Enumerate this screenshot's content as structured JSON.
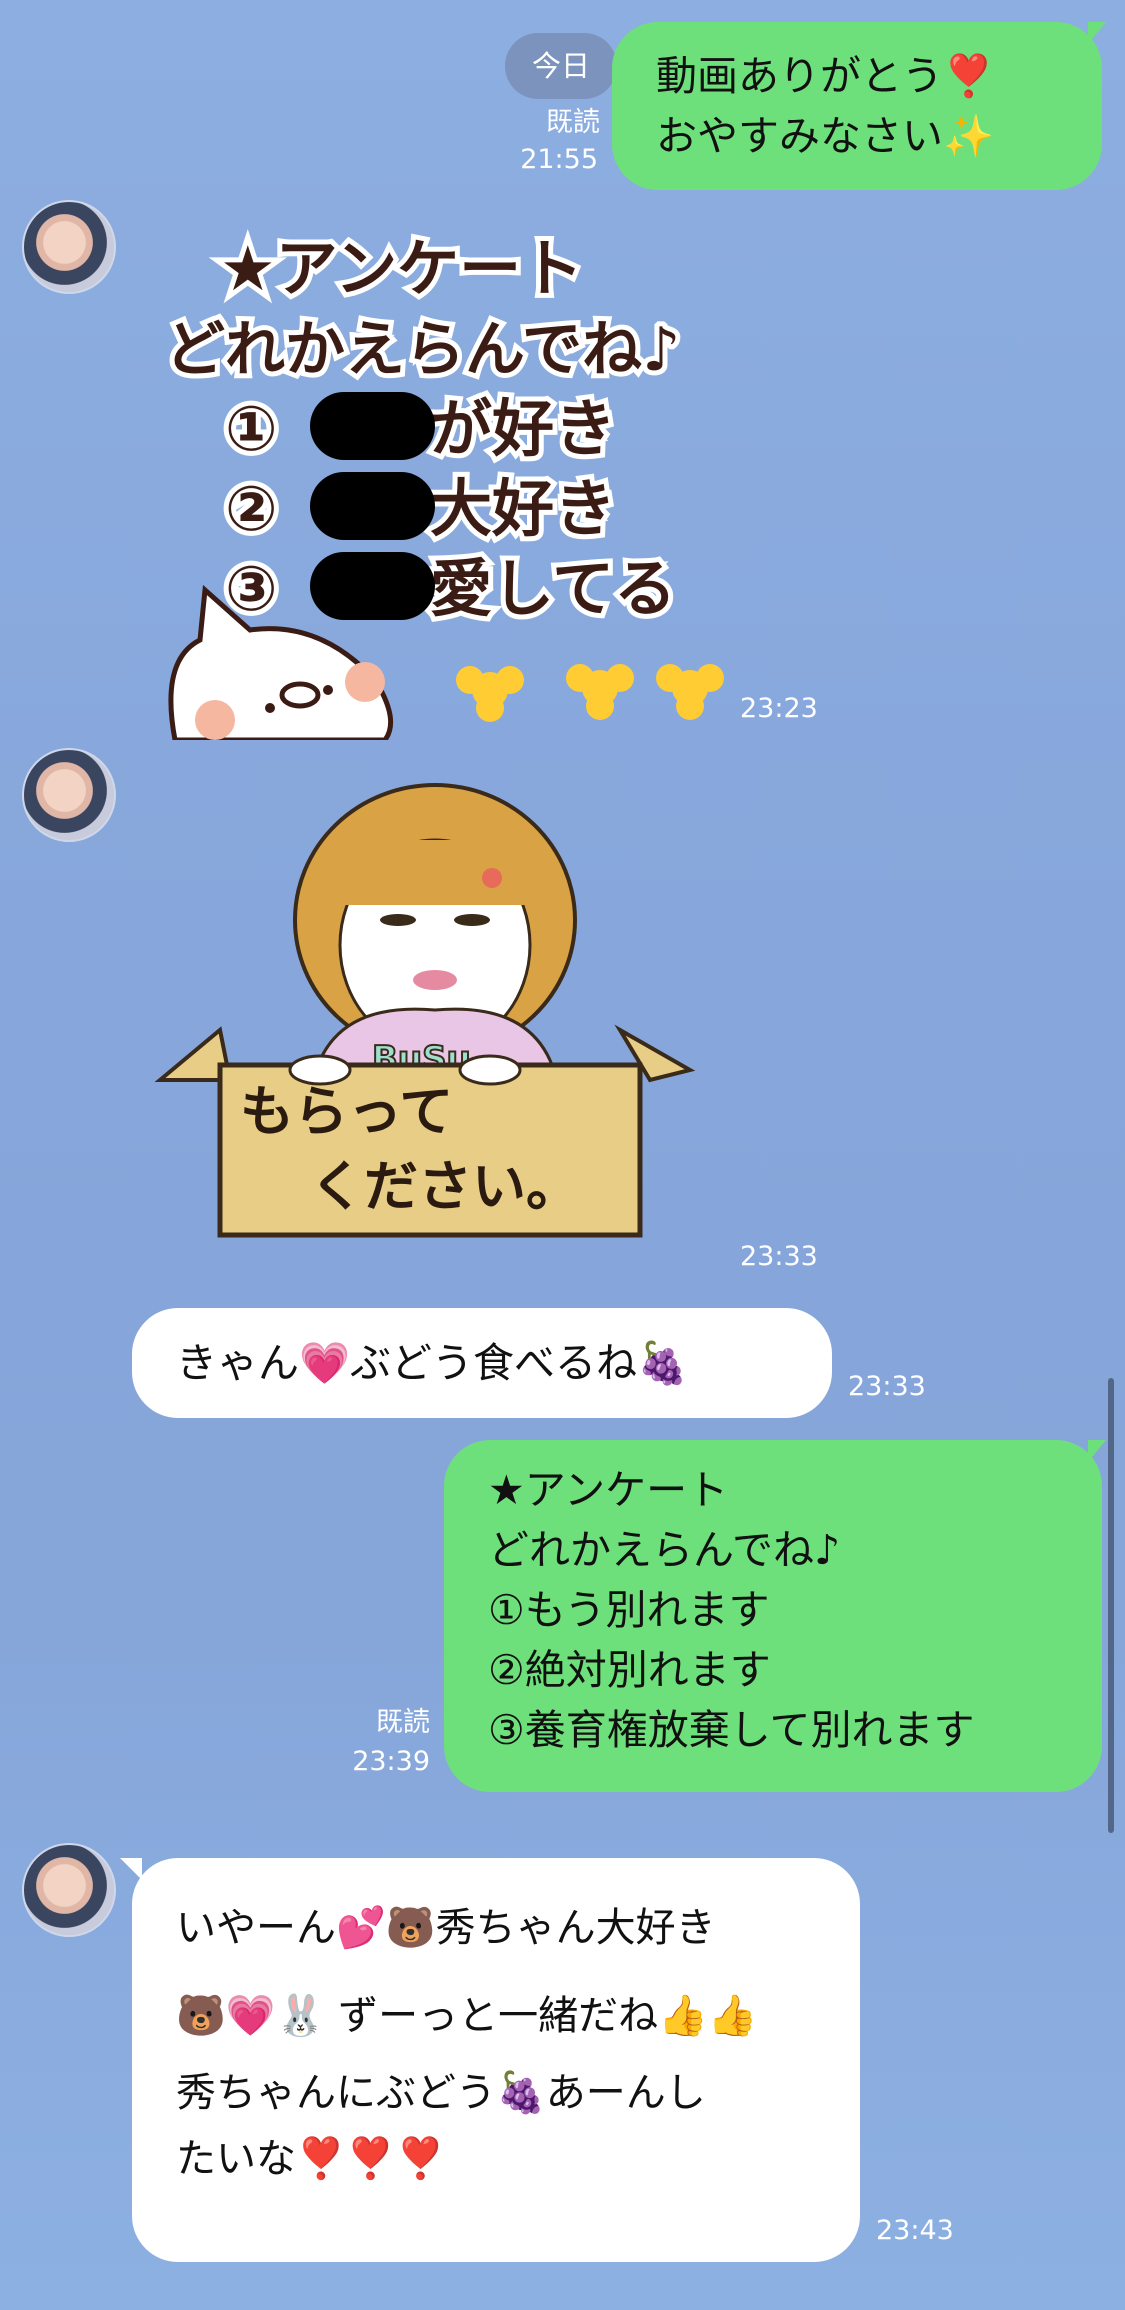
{
  "date_label": "今日",
  "messages": [
    {
      "id": "m1",
      "side": "right",
      "type": "text",
      "lines": [
        "動画ありがとう❣️",
        "おやすみなさい✨"
      ],
      "read": "既読",
      "time": "21:55"
    },
    {
      "id": "m2",
      "side": "left",
      "type": "sticker",
      "sticker_text": [
        "★アンケート",
        "どれかえらんでね♪",
        "①",
        "が好き",
        "②",
        "大好き",
        "③",
        "愛してる"
      ],
      "time": "23:23"
    },
    {
      "id": "m3",
      "side": "left",
      "type": "sticker",
      "sticker_text": [
        "BuSu",
        "もらって",
        "ください。"
      ],
      "time": "23:33"
    },
    {
      "id": "m4",
      "side": "left",
      "type": "text",
      "lines": [
        "きゃん💗ぶどう食べるね🍇"
      ],
      "time": "23:33"
    },
    {
      "id": "m5",
      "side": "right",
      "type": "text",
      "lines": [
        "★アンケート",
        "どれかえらんでね♪",
        "①もう別れます",
        "②絶対別れます",
        "③養育権放棄して別れます"
      ],
      "read": "既読",
      "time": "23:39"
    },
    {
      "id": "m6",
      "side": "left",
      "type": "text",
      "lines": [
        "いやーん💕🐻秀ちゃん大好き",
        "🐻💗🐰 ずーっと一緒だね👍👍",
        "秀ちゃんにぶどう🍇あーんし",
        "たいな❣️❣️❣️"
      ],
      "time": "23:43"
    }
  ],
  "colors": {
    "background": "#8daee0",
    "bubble_sent": "#6ee07b",
    "bubble_received": "#ffffff"
  }
}
